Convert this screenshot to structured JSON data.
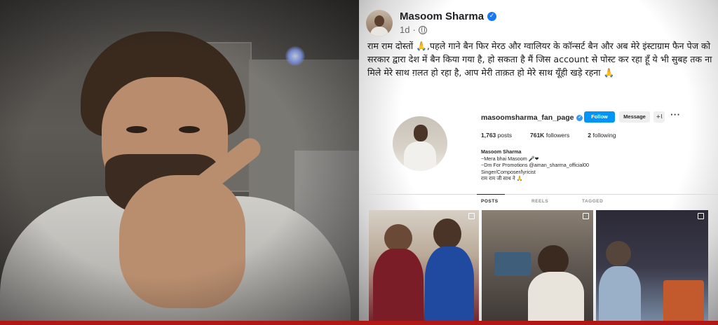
{
  "post": {
    "author": "Masoom Sharma",
    "time": "1d",
    "separator": "·",
    "text": "राम राम दोस्तों 🙏,पहले गाने बैन फिर मेरठ और ग्वालियर के कॉन्सर्ट बैन और अब मेरे इंस्टाग्राम फैन पेज को सरकार द्वारा देश में बैन किया गया है, हो सकता है मैं जिस account से पोस्ट कर रहा हूँ ये भी सुबह तक ना मिले मेरे साथ ग़लत हो रहा है, आप मेरी ताक़त हो मेरे साथ यूँही खड़े रहना 🙏"
  },
  "instagram": {
    "handle": "masoomsharma_fan_page",
    "follow_label": "Follow",
    "message_label": "Message",
    "add_label": "+𝗅",
    "more_label": "···",
    "stats": {
      "posts_value": "1,763",
      "posts_label": "posts",
      "followers_value": "761K",
      "followers_label": "followers",
      "following_value": "2",
      "following_label": "following"
    },
    "bio": {
      "name": "Masoom Sharma",
      "line1": "~Mera bhai Masoom 🎤❤",
      "line2": "~Dm For Promotions @aman_sharma_official00",
      "line3": "Singer/Composer/lyricist",
      "line4": "राम राम जी साथ ने 🙏"
    },
    "tabs": [
      "POSTS",
      "REELS",
      "TAGGED"
    ]
  },
  "icons": {
    "verified": "verified-badge-icon",
    "audience": "globe-icon",
    "pin": "pinned-post-icon"
  },
  "colors": {
    "facebook_blue": "#1877f2",
    "instagram_blue": "#0095f6",
    "bottom_bar": "#b01818"
  }
}
